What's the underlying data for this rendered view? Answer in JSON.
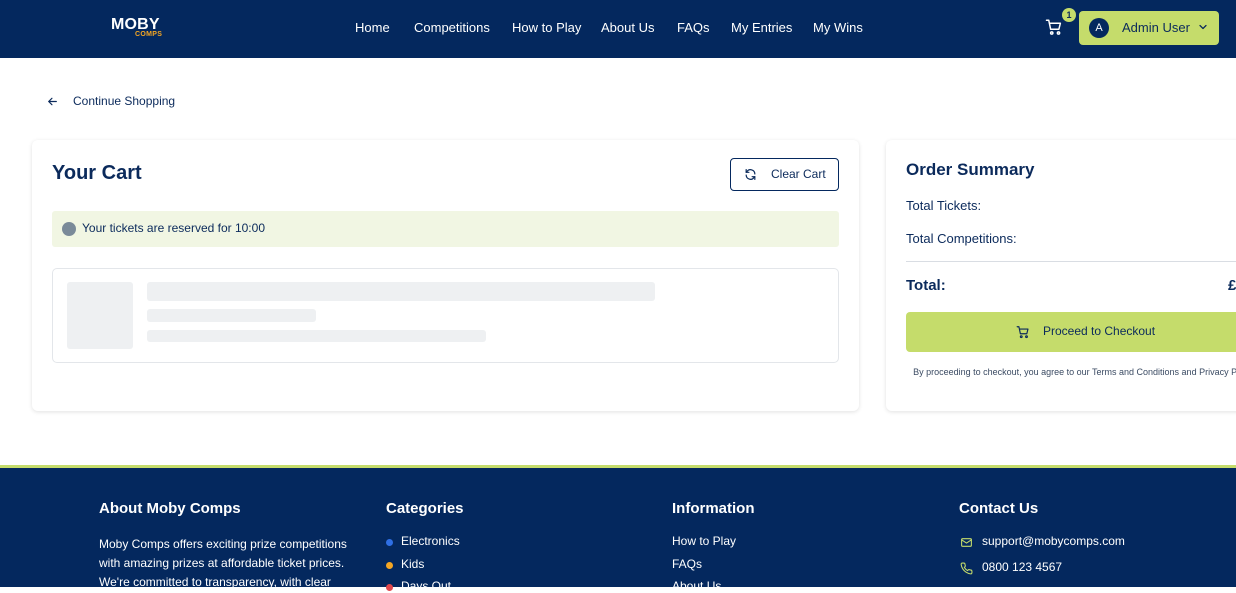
{
  "header": {
    "logo_main": "MOBY",
    "logo_sub": "COMPS",
    "nav": [
      "Home",
      "Competitions",
      "How to Play",
      "About Us",
      "FAQs",
      "My Entries",
      "My Wins"
    ],
    "cart_count": "1",
    "user_initial": "A",
    "user_name": "Admin User"
  },
  "back_link": "Continue Shopping",
  "cart": {
    "title": "Your Cart",
    "clear_label": "Clear Cart",
    "reservation_text": "Your tickets are reserved for 10:00"
  },
  "summary": {
    "title": "Order Summary",
    "total_tickets_label": "Total Tickets:",
    "total_competitions_label": "Total Competitions:",
    "total_label": "Total:",
    "total_value": "£",
    "checkout_label": "Proceed to Checkout",
    "note": "By proceeding to checkout, you agree to our Terms and Conditions and Privacy Policy."
  },
  "footer": {
    "about_title": "About Moby Comps",
    "about_text": "Moby Comps offers exciting prize competitions with amazing prizes at affordable ticket prices. We're committed to transparency, with clear",
    "categories_title": "Categories",
    "categories": [
      {
        "label": "Electronics",
        "color": "#2f6fe4"
      },
      {
        "label": "Kids",
        "color": "#f5a623"
      },
      {
        "label": "Days Out",
        "color": "#e0474c"
      }
    ],
    "info_title": "Information",
    "info_links": [
      "How to Play",
      "FAQs",
      "About Us"
    ],
    "contact_title": "Contact Us",
    "contact_email": "support@mobycomps.com",
    "contact_phone": "0800 123 4567"
  },
  "colors": {
    "navy": "#04285e",
    "accent": "#c5dc6b",
    "reserve_bg": "#f1f6e3"
  }
}
